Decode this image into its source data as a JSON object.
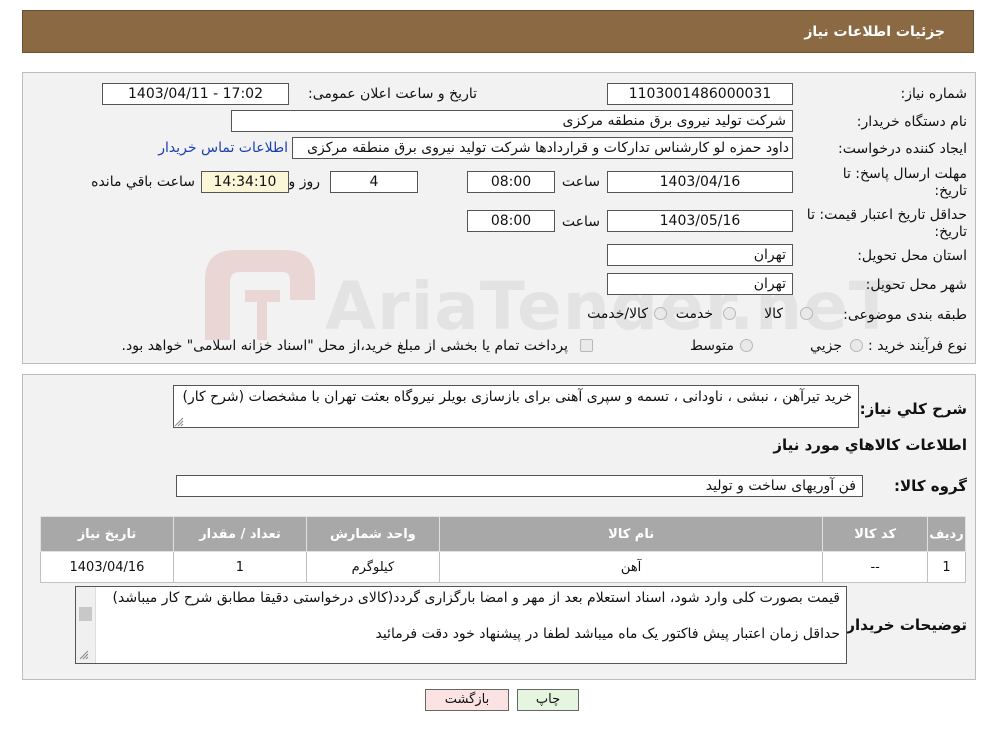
{
  "header": {
    "title": "جزئیات اطلاعات نیاز"
  },
  "form": {
    "need_number_label": "شماره نیاز:",
    "need_number": "1103001486000031",
    "announce_datetime_label": "تاریخ و ساعت اعلان عمومی:",
    "announce_datetime": "1403/04/11 - 17:02",
    "buyer_org_label": "نام دستگاه خریدار:",
    "buyer_org": "شرکت تولید نیروی برق منطقه مرکزی",
    "requester_label": "ایجاد کننده درخواست:",
    "requester": "داود حمزه لو کارشناس تدارکات و قراردادها شرکت تولید نیروی برق منطقه مرکزی",
    "buyer_contact_link": "اطلاعات تماس خریدار",
    "response_deadline_label_1": "مهلت ارسال پاسخ: تا",
    "response_deadline_label_2": "تاریخ:",
    "response_date": "1403/04/16",
    "time_label": "ساعت",
    "response_time": "08:00",
    "days_value": "4",
    "days_label": "روز و",
    "remaining_time": "14:34:10",
    "remaining_label": "ساعت باقي مانده",
    "price_validity_label_1": "حداقل تاریخ اعتبار قیمت: تا",
    "price_validity_label_2": "تاریخ:",
    "price_validity_date": "1403/05/16",
    "price_validity_time": "08:00",
    "province_label": "استان محل تحویل:",
    "province": "تهران",
    "city_label": "شهر محل تحویل:",
    "city": "تهران",
    "category_label": "طبقه بندی موضوعی:",
    "category_options": [
      "کالا",
      "خدمت",
      "کالا/خدمت"
    ],
    "purchase_type_label": "نوع فرآیند خرید :",
    "purchase_type_options": [
      "جزيي",
      "متوسط"
    ],
    "payment_note": "پرداخت تمام یا بخشی از مبلغ خرید،از محل \"اسناد خزانه اسلامی\" خواهد بود."
  },
  "summary": {
    "label": "شرح كلي نياز:",
    "text": "خرید تیرآهن ، نبشی ، ناودانی ، تسمه و سپری آهنی برای بازسازی بویلر نیروگاه بعثت تهران  با مشخصات (شرح کار)"
  },
  "goods": {
    "section_title": "اطلاعات كالاهاي مورد نياز",
    "group_label": "گروه کالا:",
    "group_value": "فن آوریهای ساخت و تولید",
    "columns": [
      "رديف",
      "کد کالا",
      "نام کالا",
      "واحد شمارش",
      "تعداد / مقدار",
      "تاریخ نیاز"
    ],
    "rows": [
      [
        "1",
        "--",
        "آهن",
        "کیلوگرم",
        "1",
        "1403/04/16"
      ]
    ]
  },
  "buyer_notes": {
    "label": "توضیحات خریدار:",
    "line1": "قیمت بصورت کلی وارد شود، اسناد استعلام بعد از مهر و امضا بارگزاری گردد(کالای درخواستی دقیقا مطابق شرح کار میباشد)",
    "line2": "حداقل زمان اعتبار پیش فاکتور یک ماه میباشد لطفا در پیشنهاد خود دقت فرمائید"
  },
  "buttons": {
    "print": "چاپ",
    "back": "بازگشت"
  },
  "watermark": {
    "text": "AriaTender.neT"
  },
  "colors": {
    "header_bg": "#8b6a43",
    "link": "#1a3fb0",
    "back_button_bg": "#fbe3e3",
    "print_button_bg": "#e6f5df"
  }
}
